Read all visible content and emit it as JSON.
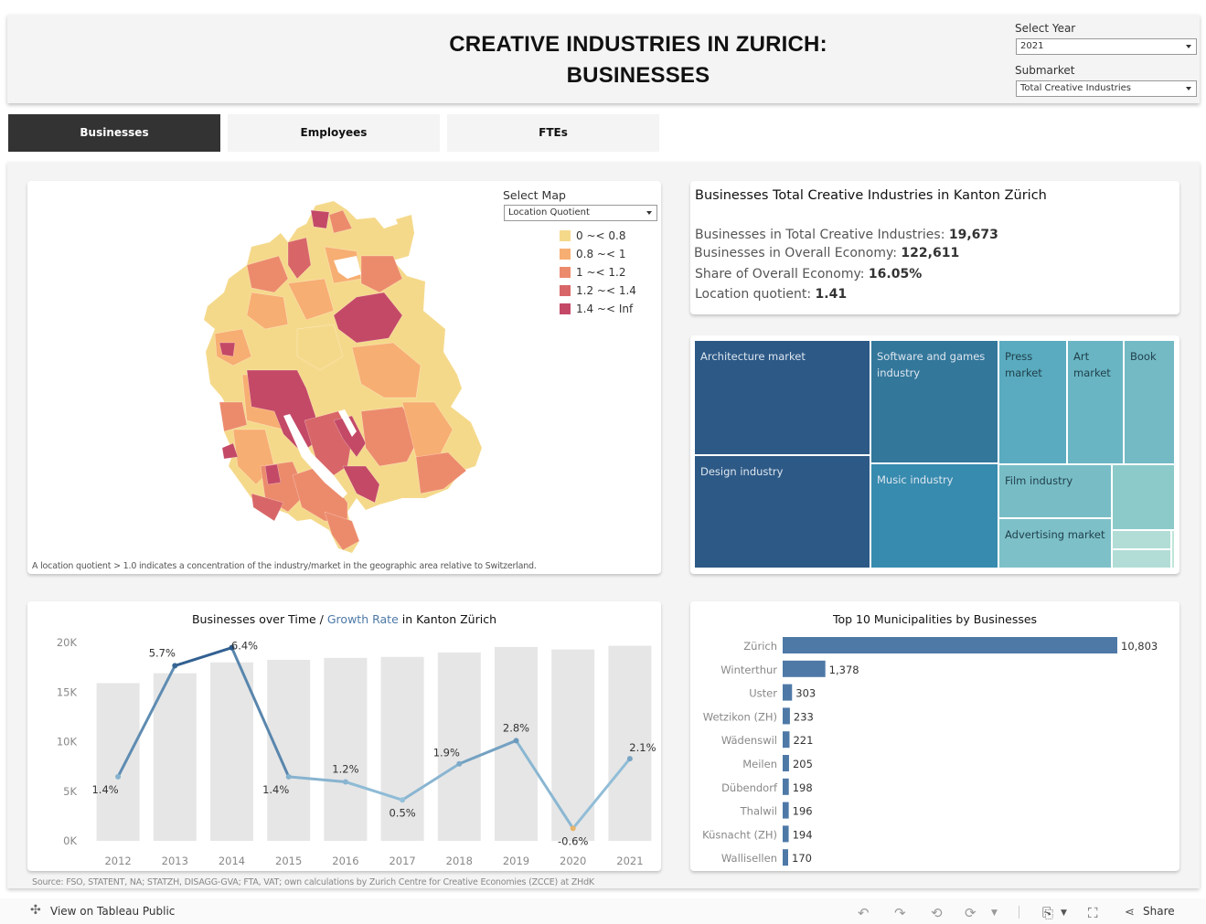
{
  "header": {
    "title_line1": "CREATIVE INDUSTRIES IN ZURICH:",
    "title_line2": "BUSINESSES",
    "year_label": "Select Year",
    "year_value": "2021",
    "submarket_label": "Submarket",
    "submarket_value": "Total Creative Industries"
  },
  "tabs": [
    {
      "label": "Businesses",
      "active": true
    },
    {
      "label": "Employees",
      "active": false
    },
    {
      "label": "FTEs",
      "active": false
    }
  ],
  "map": {
    "select_label": "Select Map",
    "select_value": "Location Quotient",
    "legend": [
      {
        "label": "0 ~< 0.8",
        "color": "#f5d98b"
      },
      {
        "label": "0.8 ~< 1",
        "color": "#f7ae72"
      },
      {
        "label": "1 ~< 1.2",
        "color": "#ec8b6c"
      },
      {
        "label": "1.2 ~< 1.4",
        "color": "#d86668"
      },
      {
        "label": "1.4 ~< Inf",
        "color": "#c44967"
      }
    ],
    "note": "A location quotient > 1.0 indicates a concentration of the industry/market in the geographic area relative to Switzerland."
  },
  "kpi": {
    "title": "Businesses Total Creative Industries in Kanton Zürich",
    "lines": [
      {
        "label": "Businesses in Total Creative Industries:",
        "value": "19,673"
      },
      {
        "label": "Businesses in Overall Economy:",
        "value": "122,611"
      },
      {
        "label": "Share of Overall Economy: ",
        "value": "16.05%"
      },
      {
        "label": "Location quotient:",
        "value": "1.41"
      }
    ]
  },
  "treemap": {
    "cells": [
      {
        "label": "Architecture market",
        "color": "#2d5986",
        "text_color": "#dde6ef"
      },
      {
        "label": "Design industry",
        "color": "#2d5986",
        "text_color": "#dde6ef"
      },
      {
        "label": "Software and games industry",
        "color": "#33779b",
        "text_color": "#dde6ef"
      },
      {
        "label": "Music industry",
        "color": "#378bae",
        "text_color": "#dde6ef"
      },
      {
        "label": "Press market",
        "color": "#5aabbf",
        "text_color": "#1f3f4a"
      },
      {
        "label": "Art market",
        "color": "#69b5c3",
        "text_color": "#1f3f4a"
      },
      {
        "label": "Book",
        "color": "#73bac5",
        "text_color": "#1f3f4a"
      },
      {
        "label": "Film industry",
        "color": "#78bdc6",
        "text_color": "#1f3f4a"
      },
      {
        "label": "Advertising market",
        "color": "#7dc0c8",
        "text_color": "#1f3f4a"
      },
      {
        "label": "",
        "color": "#8ccaca",
        "text_color": "#1f3f4a"
      },
      {
        "label": "",
        "color": "#b1ddd6",
        "text_color": "#1f3f4a"
      },
      {
        "label": "",
        "color": "#b1ddd6",
        "text_color": "#1f3f4a"
      },
      {
        "label": "",
        "color": "#c0e6da",
        "text_color": "#1f3f4a"
      }
    ]
  },
  "time_chart": {
    "title_pre": "Businesses over Time / ",
    "title_highlight": "Growth Rate",
    "title_post": " in Kanton Zürich",
    "highlight_color": "#4e79a7"
  },
  "top10": {
    "title": "Top 10 Municipalities by Businesses",
    "bar_color": "#4e79a7"
  },
  "source": "Source: FSO, STATENT, NA; STATZH, DISAGG-GVA; FTA, VAT; own calculations by Zurich Centre for Creative Economies (ZCCE) at ZHdK",
  "footer": {
    "view_link": "View on Tableau Public",
    "share_label": "Share"
  },
  "chart_data": [
    {
      "type": "bar",
      "title": "Businesses over Time / Growth Rate in Kanton Zürich",
      "categories": [
        "2012",
        "2013",
        "2014",
        "2015",
        "2016",
        "2017",
        "2018",
        "2019",
        "2020",
        "2021"
      ],
      "series": [
        {
          "name": "Businesses",
          "type": "bar",
          "values": [
            15900,
            16900,
            18000,
            18250,
            18450,
            18550,
            19000,
            19550,
            19300,
            19673
          ]
        },
        {
          "name": "Growth Rate",
          "type": "line",
          "values": [
            1.4,
            5.7,
            6.4,
            1.4,
            1.2,
            0.5,
            1.9,
            2.8,
            -0.6,
            2.1
          ],
          "labels": [
            "1.4%",
            "5.7%",
            "6.4%",
            "1.4%",
            "1.2%",
            "0.5%",
            "1.9%",
            "2.8%",
            "-0.6%",
            "2.1%"
          ]
        }
      ],
      "ylabel": "",
      "xlabel": "",
      "ylim": [
        0,
        20000
      ],
      "yticks": [
        "0K",
        "5K",
        "10K",
        "15K",
        "20K"
      ],
      "growth_range": [
        -0.6,
        6.4
      ]
    },
    {
      "type": "bar",
      "orientation": "horizontal",
      "title": "Top 10 Municipalities by Businesses",
      "categories": [
        "Zürich",
        "Winterthur",
        "Uster",
        "Wetzikon (ZH)",
        "Wädenswil",
        "Meilen",
        "Dübendorf",
        "Thalwil",
        "Küsnacht (ZH)",
        "Wallisellen"
      ],
      "values": [
        10803,
        1378,
        303,
        233,
        221,
        205,
        198,
        196,
        194,
        170
      ],
      "labels": [
        "10,803",
        "1,378",
        "303",
        "233",
        "221",
        "205",
        "198",
        "196",
        "194",
        "170"
      ]
    }
  ]
}
